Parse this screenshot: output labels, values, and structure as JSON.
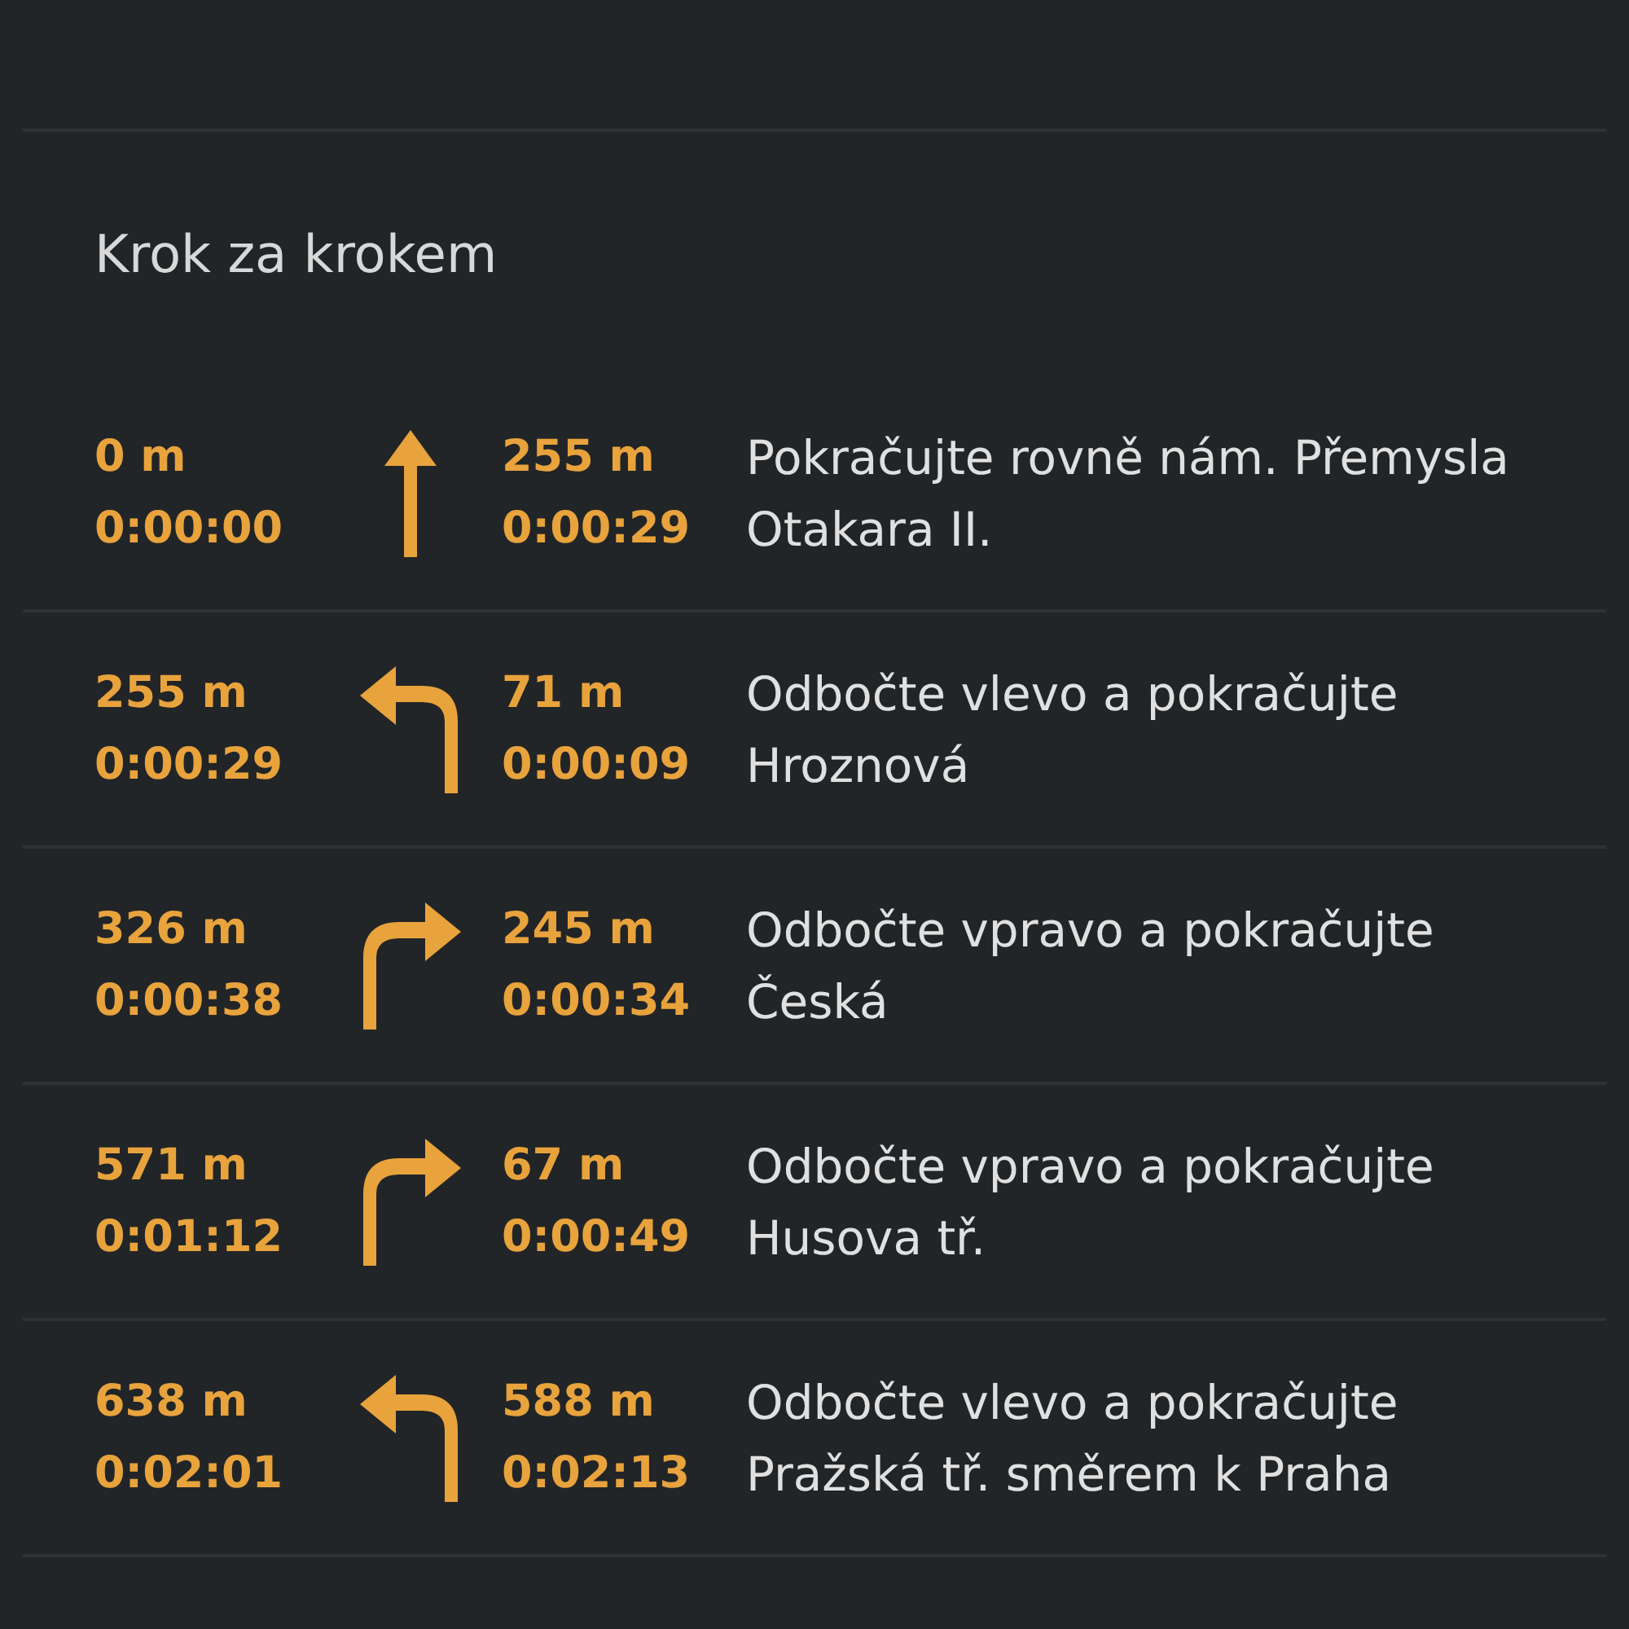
{
  "section_title": "Krok za krokem",
  "steps": [
    {
      "kind": "straight",
      "distance_from_start": "0 m",
      "time_from_start": "0:00:00",
      "distance": "255 m",
      "time": "0:00:29",
      "instruction": "Pokračujte rovně nám. Přemysla Otakara II."
    },
    {
      "kind": "left",
      "distance_from_start": "255 m",
      "time_from_start": "0:00:29",
      "distance": "71 m",
      "time": "0:00:09",
      "instruction": "Odbočte vlevo a pokračujte Hroznová"
    },
    {
      "kind": "right",
      "distance_from_start": "326 m",
      "time_from_start": "0:00:38",
      "distance": "245 m",
      "time": "0:00:34",
      "instruction": "Odbočte vpravo a pokračujte Česká"
    },
    {
      "kind": "right",
      "distance_from_start": "571 m",
      "time_from_start": "0:01:12",
      "distance": "67 m",
      "time": "0:00:49",
      "instruction": "Odbočte vpravo a pokračujte Husova tř."
    },
    {
      "kind": "left",
      "distance_from_start": "638 m",
      "time_from_start": "0:02:01",
      "distance": "588 m",
      "time": "0:02:13",
      "instruction": "Odbočte vlevo a pokračujte Pražská tř. směrem k Praha"
    }
  ]
}
